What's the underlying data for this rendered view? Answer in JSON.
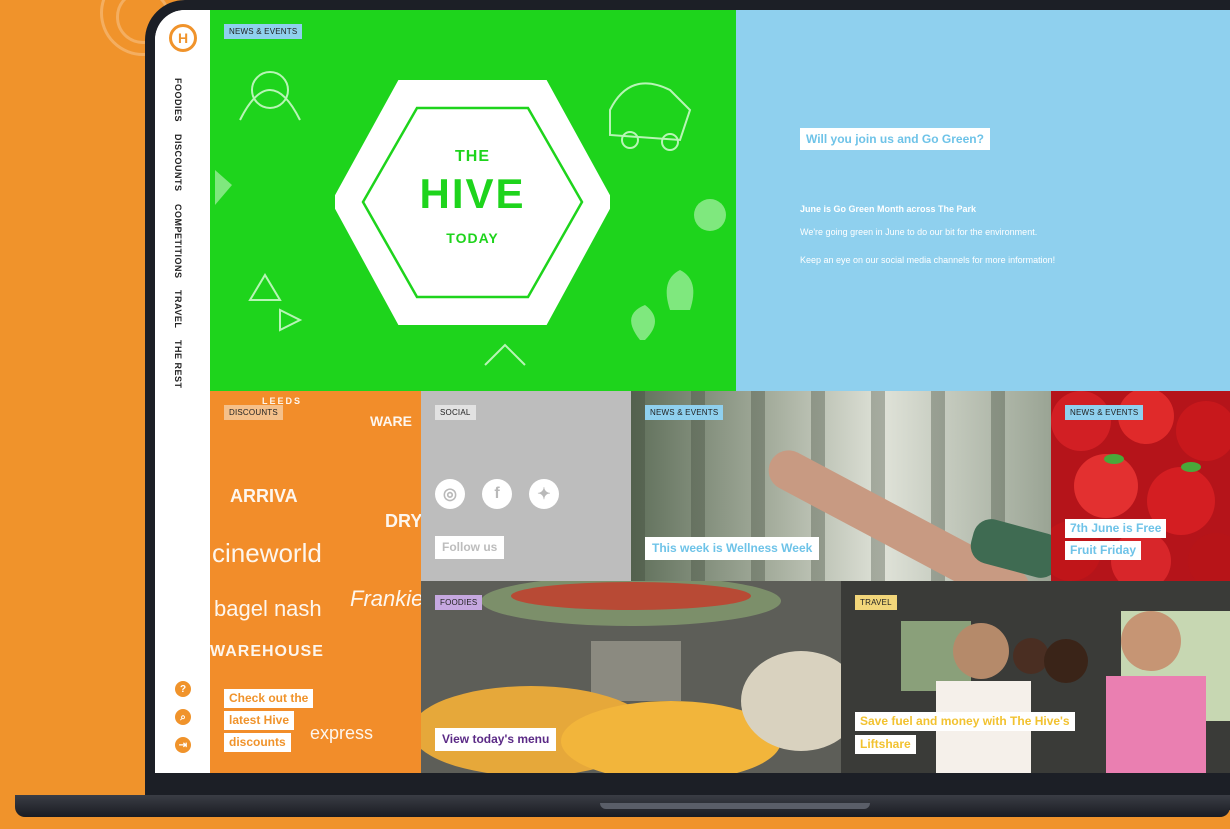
{
  "nav": {
    "logo": "H",
    "items": [
      "FOODIES",
      "DISCOUNTS",
      "COMPETITIONS",
      "TRAVEL",
      "THE REST"
    ],
    "help": "?",
    "search": "⌕",
    "login": "⇥"
  },
  "hero": {
    "tag": "NEWS & EVENTS",
    "title_top": "THE",
    "title_main": "HIVE",
    "title_bottom": "TODAY"
  },
  "promo": {
    "heading": "Will you join us and Go Green?",
    "subheading": "June is Go Green Month across The Park",
    "para1": "We're going green in June to do our bit for the environment.",
    "para2": "Keep an eye on our social media channels for more information!"
  },
  "tiles": {
    "discounts": {
      "tag": "DISCOUNTS",
      "line1": "Check out the",
      "line2": "latest Hive",
      "line3": "discounts",
      "brands": [
        "ARRIVA",
        "cineworld",
        "bagel nash",
        "WAREHOUSE",
        "Frankie",
        "express",
        "LEEDS",
        "WARE",
        "DRY"
      ]
    },
    "social": {
      "tag": "SOCIAL",
      "caption": "Follow us",
      "icons": [
        "instagram-icon",
        "facebook-icon",
        "twitter-icon"
      ]
    },
    "wellness": {
      "tag": "NEWS & EVENTS",
      "caption": "This week is Wellness Week"
    },
    "fruit": {
      "tag": "NEWS & EVENTS",
      "line1": "7th June is Free",
      "line2": "Fruit Friday"
    },
    "foodies": {
      "tag": "FOODIES",
      "caption": "View today's menu"
    },
    "travel": {
      "tag": "TRAVEL",
      "line1": "Save fuel and money with The Hive's",
      "line2": "Liftshare"
    }
  },
  "colors": {
    "orange": "#f0932b",
    "green": "#1ed41c",
    "blue": "#8fd0ee",
    "grey": "#bdbdbd",
    "purple": "#5b2a86"
  }
}
